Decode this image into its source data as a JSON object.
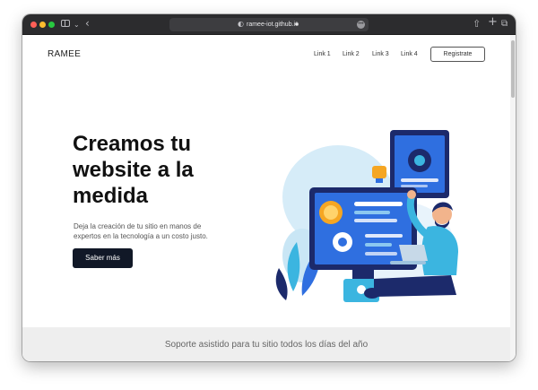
{
  "browser": {
    "address": "ramee-iot.github.io",
    "icons": [
      "sidebar-icon",
      "chevron-down-icon",
      "back-icon",
      "shield-icon",
      "lock-icon",
      "more-icon",
      "share-icon",
      "plus-icon",
      "tabs-icon"
    ]
  },
  "header": {
    "brand": "RAMEE",
    "links": [
      "Link 1",
      "Link 2",
      "Link 3",
      "Link 4"
    ],
    "register_label": "Registrate"
  },
  "hero": {
    "title_lines": [
      "Creamos tu",
      "website a la",
      "medida"
    ],
    "subtitle_lines": [
      "Deja la creación de tu sitio en manos de",
      "expertos en la tecnología a un costo justo."
    ],
    "cta_label": "Saber más"
  },
  "footer": {
    "text": "Soporte asistido para tu sitio todos los días del año"
  },
  "colors": {
    "titlebar": "#2c2c2e",
    "cta_background": "#111827",
    "footer_band": "#eeeeee",
    "illustration_blue": "#2f6fe0",
    "illustration_navy": "#1c2a6b"
  }
}
